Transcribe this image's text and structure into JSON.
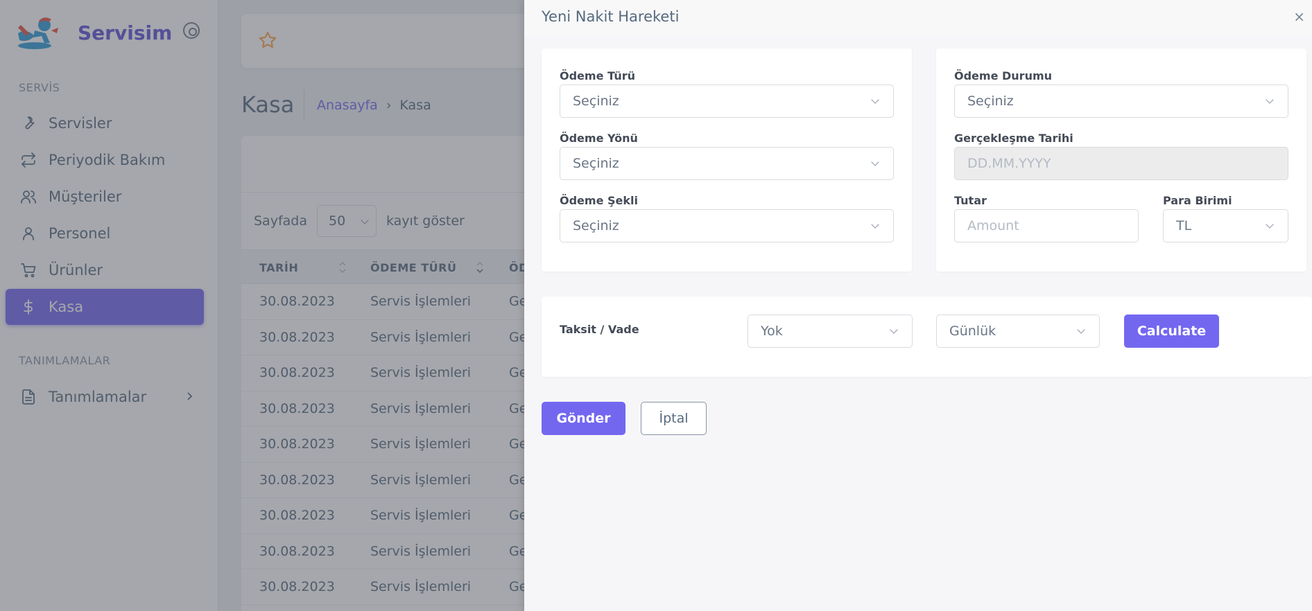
{
  "sidebar": {
    "brand": "Servisim",
    "section_servis": "SERVİS",
    "section_tanimlamalar": "TANIMLAMALAR",
    "items": [
      {
        "label": "Servisler",
        "icon": "wrench-icon"
      },
      {
        "label": "Periyodik Bakım",
        "icon": "repeat-icon"
      },
      {
        "label": "Müşteriler",
        "icon": "users-icon"
      },
      {
        "label": "Personel",
        "icon": "user-icon"
      },
      {
        "label": "Ürünler",
        "icon": "cart-icon"
      },
      {
        "label": "Kasa",
        "icon": "dollar-icon",
        "active": true
      },
      {
        "label": "Tanımlamalar",
        "icon": "file-icon"
      }
    ]
  },
  "page": {
    "title": "Kasa",
    "breadcrumb_home": "Anasayfa",
    "breadcrumb_separator": "›",
    "breadcrumb_current": "Kasa"
  },
  "table": {
    "length_prefix": "Sayfada",
    "length_value": "50",
    "length_suffix": "kayıt göster",
    "headers": [
      "TARİH",
      "ÖDEME TÜRÜ",
      "ÖD"
    ],
    "rows": [
      {
        "tarih": "30.08.2023",
        "odeme_turu": "Servis İşlemleri",
        "cut": "Ge"
      },
      {
        "tarih": "30.08.2023",
        "odeme_turu": "Servis İşlemleri",
        "cut": "Ge"
      },
      {
        "tarih": "30.08.2023",
        "odeme_turu": "Servis İşlemleri",
        "cut": "Ge"
      },
      {
        "tarih": "30.08.2023",
        "odeme_turu": "Servis İşlemleri",
        "cut": "Ge"
      },
      {
        "tarih": "30.08.2023",
        "odeme_turu": "Servis İşlemleri",
        "cut": "Ge"
      },
      {
        "tarih": "30.08.2023",
        "odeme_turu": "Servis İşlemleri",
        "cut": "Ge"
      },
      {
        "tarih": "30.08.2023",
        "odeme_turu": "Servis İşlemleri",
        "cut": "Ge"
      },
      {
        "tarih": "30.08.2023",
        "odeme_turu": "Servis İşlemleri",
        "cut": "Ge"
      },
      {
        "tarih": "30.08.2023",
        "odeme_turu": "Servis İşlemleri",
        "cut": "Ge"
      }
    ]
  },
  "offcanvas": {
    "title": "Yeni Nakit Hareketi",
    "close": "×",
    "odeme_turu": {
      "label": "Ödeme Türü",
      "value": "Seçiniz"
    },
    "odeme_yonu": {
      "label": "Ödeme Yönü",
      "value": "Seçiniz"
    },
    "odeme_sekli": {
      "label": "Ödeme Şekli",
      "value": "Seçiniz"
    },
    "odeme_durumu": {
      "label": "Ödeme Durumu",
      "value": "Seçiniz"
    },
    "gerceklesme_tarihi": {
      "label": "Gerçekleşme Tarihi",
      "placeholder": "DD.MM.YYYY"
    },
    "tutar": {
      "label": "Tutar",
      "placeholder": "Amount"
    },
    "para_birimi": {
      "label": "Para Birimi",
      "value": "TL"
    },
    "taksit": {
      "label": "Taksit / Vade",
      "taksit_value": "Yok",
      "vade_value": "Günlük",
      "calculate": "Calculate"
    },
    "submit": "Gönder",
    "cancel": "İptal"
  },
  "colors": {
    "primary": "#7367f0",
    "text": "#566a7f"
  }
}
